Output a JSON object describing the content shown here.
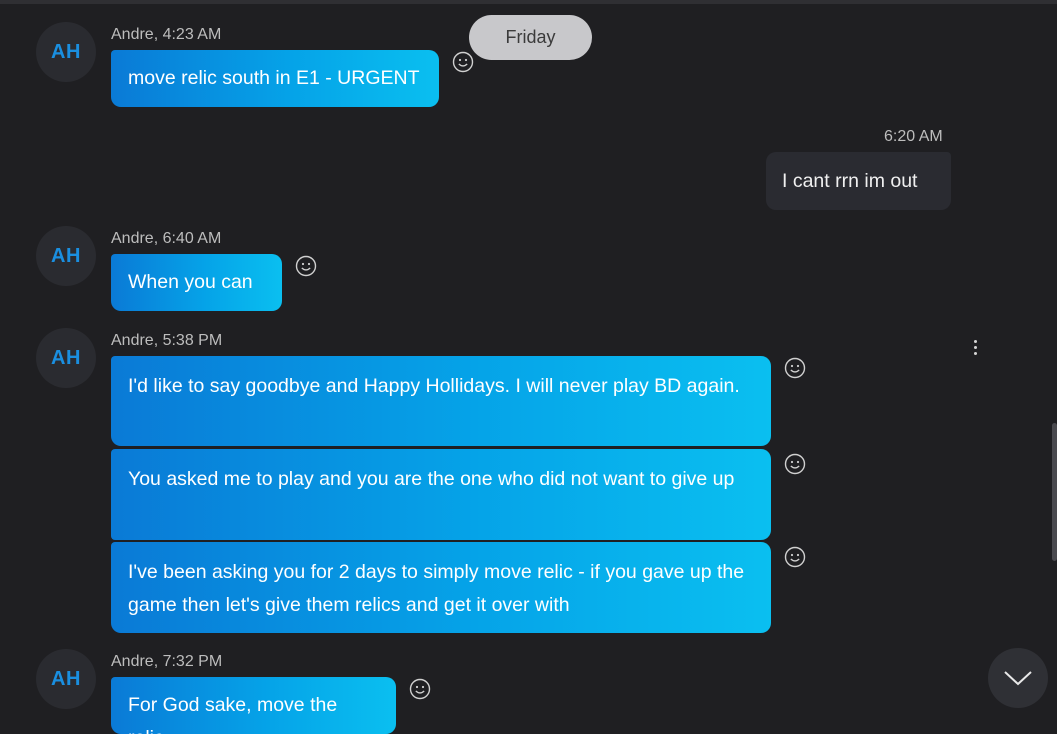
{
  "date_separator": "Friday",
  "outgoing": {
    "time": "6:20 AM",
    "text": "I cant rrn im out"
  },
  "groups": [
    {
      "initials": "AH",
      "meta": "Andre, 4:23 AM",
      "messages": [
        "move relic south in E1 - URGENT"
      ]
    },
    {
      "initials": "AH",
      "meta": "Andre, 6:40 AM",
      "messages": [
        "When you can"
      ]
    },
    {
      "initials": "AH",
      "meta": "Andre, 5:38 PM",
      "messages": [
        "I'd like to say goodbye and Happy Hollidays. I will never play BD again.",
        "You asked me to play and you are the one who did not want to give up",
        "I've been asking you for 2 days to simply move relic - if you gave up the game then let's give them relics and get it over with"
      ]
    },
    {
      "initials": "AH",
      "meta": "Andre, 7:32 PM",
      "messages": [
        "For God sake, move the relic"
      ]
    }
  ],
  "icons": {
    "reaction": "smiley-icon",
    "more": "more-vertical-icon",
    "scroll": "chevron-down-icon"
  },
  "colors": {
    "background": "#1f1f22",
    "incoming_bubble_start": "#0a7ad6",
    "incoming_bubble_end": "#0abff0",
    "outgoing_bubble": "#2a2b31",
    "avatar_text": "#1a8fe0"
  }
}
